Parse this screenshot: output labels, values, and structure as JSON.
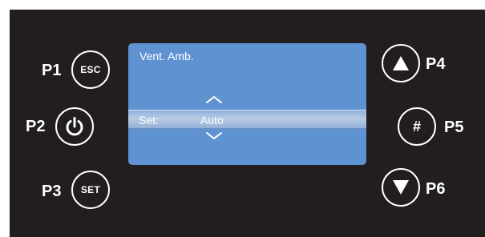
{
  "colors": {
    "panel_background": "#221e1f",
    "lcd_background": "#5f92d1",
    "lcd_text": "#ffffff",
    "selection_bar": "#b8cbe3",
    "button_ring": "#ffffff"
  },
  "screen": {
    "title": "Vent. Amb.",
    "selected_row": {
      "label": "Set:",
      "value": "Auto"
    },
    "up_icon": "chevron-up-icon",
    "down_icon": "chevron-down-icon"
  },
  "buttons": [
    {
      "id": "P1",
      "label": "P1",
      "glyph_text": "ESC",
      "icon": "esc-text-icon"
    },
    {
      "id": "P2",
      "label": "P2",
      "glyph_text": "",
      "icon": "power-icon"
    },
    {
      "id": "P3",
      "label": "P3",
      "glyph_text": "SET",
      "icon": "set-text-icon"
    },
    {
      "id": "P4",
      "label": "P4",
      "glyph_text": "",
      "icon": "triangle-up-icon"
    },
    {
      "id": "P5",
      "label": "P5",
      "glyph_text": "#",
      "icon": "hash-icon"
    },
    {
      "id": "P6",
      "label": "P6",
      "glyph_text": "",
      "icon": "triangle-down-icon"
    }
  ]
}
